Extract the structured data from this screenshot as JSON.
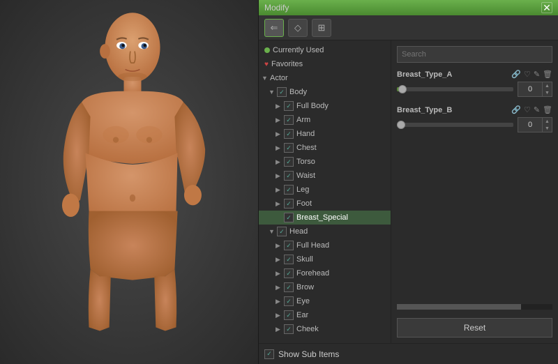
{
  "window": {
    "title": "Modify",
    "close_icon": "✕"
  },
  "toolbar": {
    "btn1_icon": "↺",
    "btn2_icon": "◇",
    "btn3_icon": "⊞"
  },
  "tree": {
    "items": [
      {
        "id": "currently-used",
        "label": "Currently Used",
        "level": 0,
        "type": "dot-green",
        "expandable": false
      },
      {
        "id": "favorites",
        "label": "Favorites",
        "level": 0,
        "type": "heart",
        "expandable": false
      },
      {
        "id": "actor",
        "label": "Actor",
        "level": 0,
        "type": "arrow-down",
        "expandable": true
      },
      {
        "id": "body",
        "label": "Body",
        "level": 1,
        "type": "checkbox-arrow",
        "expandable": true,
        "checked": true
      },
      {
        "id": "full-body",
        "label": "Full Body",
        "level": 2,
        "type": "checkbox-arrow",
        "expandable": true,
        "checked": true
      },
      {
        "id": "arm",
        "label": "Arm",
        "level": 2,
        "type": "checkbox-arrow",
        "expandable": true,
        "checked": true
      },
      {
        "id": "hand",
        "label": "Hand",
        "level": 2,
        "type": "checkbox-arrow",
        "expandable": true,
        "checked": true
      },
      {
        "id": "chest",
        "label": "Chest",
        "level": 2,
        "type": "checkbox-arrow",
        "expandable": true,
        "checked": true
      },
      {
        "id": "torso",
        "label": "Torso",
        "level": 2,
        "type": "checkbox-arrow",
        "expandable": true,
        "checked": true
      },
      {
        "id": "waist",
        "label": "Waist",
        "level": 2,
        "type": "checkbox-arrow",
        "expandable": true,
        "checked": true
      },
      {
        "id": "leg",
        "label": "Leg",
        "level": 2,
        "type": "checkbox-arrow",
        "expandable": true,
        "checked": true
      },
      {
        "id": "foot",
        "label": "Foot",
        "level": 2,
        "type": "checkbox-arrow",
        "expandable": true,
        "checked": true
      },
      {
        "id": "breast-special",
        "label": "Breast_Special",
        "level": 2,
        "type": "checkbox",
        "expandable": false,
        "checked": true,
        "selected": true
      },
      {
        "id": "head-group",
        "label": "Head",
        "level": 1,
        "type": "checkbox-arrow",
        "expandable": true,
        "checked": true
      },
      {
        "id": "full-head",
        "label": "Full Head",
        "level": 2,
        "type": "checkbox-arrow",
        "expandable": true,
        "checked": true
      },
      {
        "id": "skull",
        "label": "Skull",
        "level": 2,
        "type": "checkbox-arrow",
        "expandable": true,
        "checked": true
      },
      {
        "id": "forehead",
        "label": "Forehead",
        "level": 2,
        "type": "checkbox-arrow",
        "expandable": true,
        "checked": true
      },
      {
        "id": "brow",
        "label": "Brow",
        "level": 2,
        "type": "checkbox-arrow",
        "expandable": true,
        "checked": true
      },
      {
        "id": "eye",
        "label": "Eye",
        "level": 2,
        "type": "checkbox-arrow",
        "expandable": true,
        "checked": true
      },
      {
        "id": "ear",
        "label": "Ear",
        "level": 2,
        "type": "checkbox-arrow",
        "expandable": true,
        "checked": true
      },
      {
        "id": "cheek",
        "label": "Cheek",
        "level": 2,
        "type": "checkbox-arrow",
        "expandable": true,
        "checked": true
      }
    ]
  },
  "search": {
    "placeholder": "Search",
    "value": ""
  },
  "morphs": [
    {
      "id": "breast-type-a",
      "name": "Breast_Type_A",
      "value": "0",
      "slider_percent": 5
    },
    {
      "id": "breast-type-b",
      "name": "Breast_Type_B",
      "value": "0",
      "slider_percent": 0
    }
  ],
  "buttons": {
    "reset": "Reset"
  },
  "footer": {
    "show_sub_items": "Show Sub Items"
  }
}
